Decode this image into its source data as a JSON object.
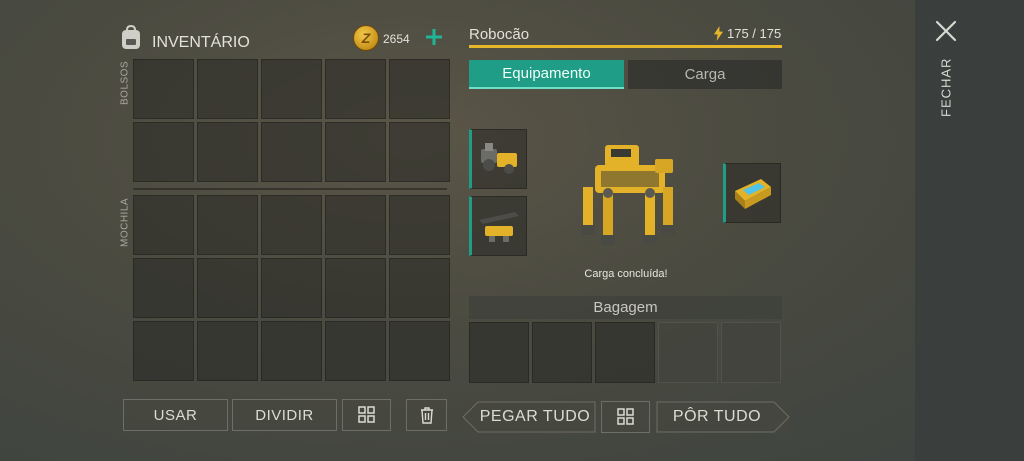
{
  "inventory": {
    "title": "INVENTÁRIO",
    "coins": "2654",
    "pockets_label": "BOLSOS",
    "backpack_label": "MOCHILA",
    "use_label": "USAR",
    "split_label": "DIVIDIR"
  },
  "robot": {
    "name": "Robocão",
    "energy": "175 / 175",
    "energy_fraction": 1.0,
    "tabs": [
      "Equipamento",
      "Carga"
    ],
    "active_tab": "Equipamento",
    "status": "Carga concluída!",
    "baggage_label": "Bagagem",
    "take_all_label": "PEGAR TUDO",
    "put_all_label": "PÔR TUDO"
  },
  "window": {
    "close_label": "FECHAR"
  },
  "colors": {
    "accent": "#1f9d87",
    "energy": "#e6b72a",
    "robot_yellow": "#e3b228"
  }
}
